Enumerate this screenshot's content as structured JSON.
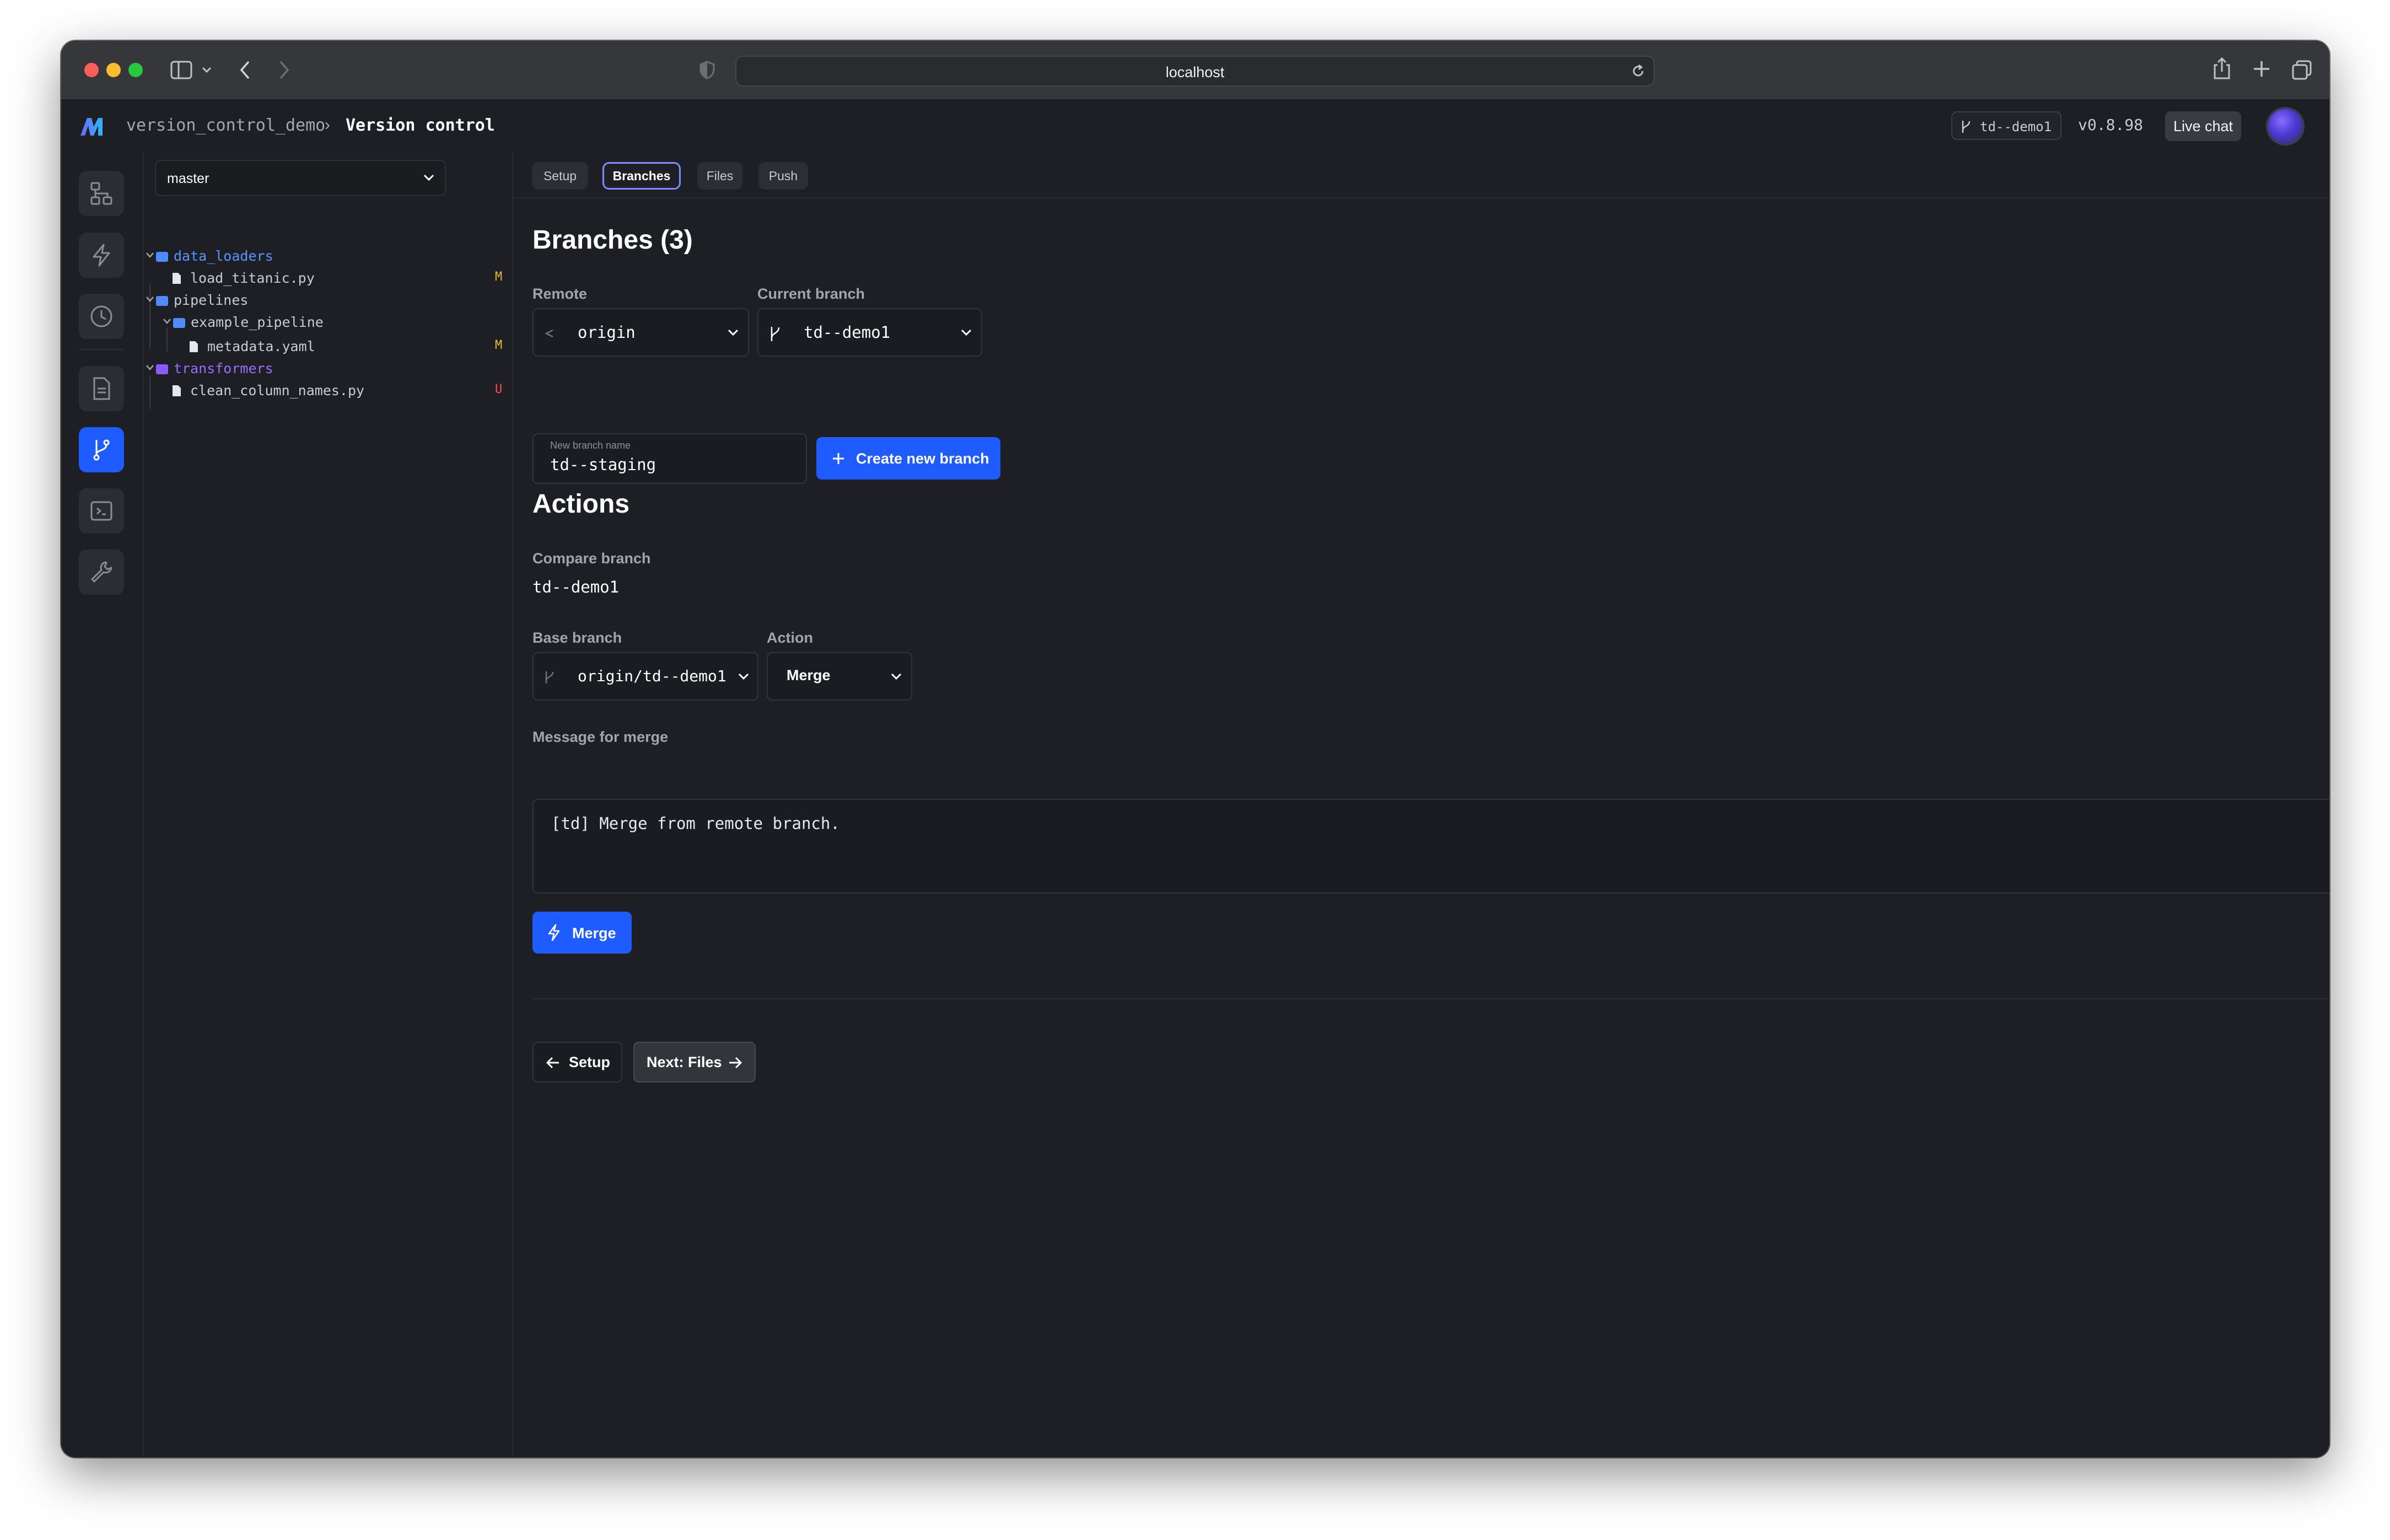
{
  "browser": {
    "url": "localhost"
  },
  "app": {
    "project": "version_control_demo",
    "separator": "›",
    "page_title": "Version control",
    "current_branch_pill": "td--demo1",
    "version": "v0.8.98",
    "live_chat_label": "Live chat"
  },
  "rail": {
    "items": [
      {
        "name": "pipelines-icon",
        "active": false
      },
      {
        "name": "triggers-icon",
        "active": false
      },
      {
        "name": "history-icon",
        "active": false
      },
      {
        "name": "files-icon",
        "active": false
      },
      {
        "name": "version-control-icon",
        "active": true
      },
      {
        "name": "terminal-icon",
        "active": false
      },
      {
        "name": "settings-icon",
        "active": false
      }
    ]
  },
  "file_tree": {
    "branch_select": "master",
    "rows": [
      {
        "label": "data_loaders",
        "type": "folder",
        "color": "#4f8bff",
        "badge": ""
      },
      {
        "label": "load_titanic.py",
        "type": "file",
        "badge": "M",
        "badge_color": "#e8b82a"
      },
      {
        "label": "pipelines",
        "type": "folder",
        "color": "#4f8bff",
        "badge": ""
      },
      {
        "label": "example_pipeline",
        "type": "folder",
        "color": "#4f8bff",
        "badge": ""
      },
      {
        "label": "metadata.yaml",
        "type": "file",
        "badge": "M",
        "badge_color": "#e8b82a"
      },
      {
        "label": "transformers",
        "type": "folder",
        "color": "#8a5cff",
        "badge": ""
      },
      {
        "label": "clean_column_names.py",
        "type": "file",
        "badge": "U",
        "badge_color": "#ff4d4d"
      }
    ]
  },
  "tabs": [
    "Setup",
    "Branches",
    "Files",
    "Push"
  ],
  "active_tab": "Branches",
  "branches": {
    "heading": "Branches (3)",
    "remote_label": "Remote",
    "remote_value": "origin",
    "current_branch_label": "Current branch",
    "current_branch_value": "td--demo1",
    "new_branch_placeholder": "New branch name",
    "new_branch_value": "td--staging",
    "create_button": "Create new branch"
  },
  "actions": {
    "heading": "Actions",
    "compare_label": "Compare branch",
    "compare_value": "td--demo1",
    "base_label": "Base branch",
    "base_value": "origin/td--demo1",
    "action_label": "Action",
    "action_value": "Merge",
    "message_label": "Message for merge",
    "message_value": "[td] Merge from remote branch.",
    "submit_button": "Merge"
  },
  "footer_nav": {
    "back_label": "Setup",
    "next_label": "Next: Files"
  },
  "colors": {
    "accent": "#1f5cff",
    "background": "#1e1f24",
    "active_tab_border": "#7d8dff"
  }
}
